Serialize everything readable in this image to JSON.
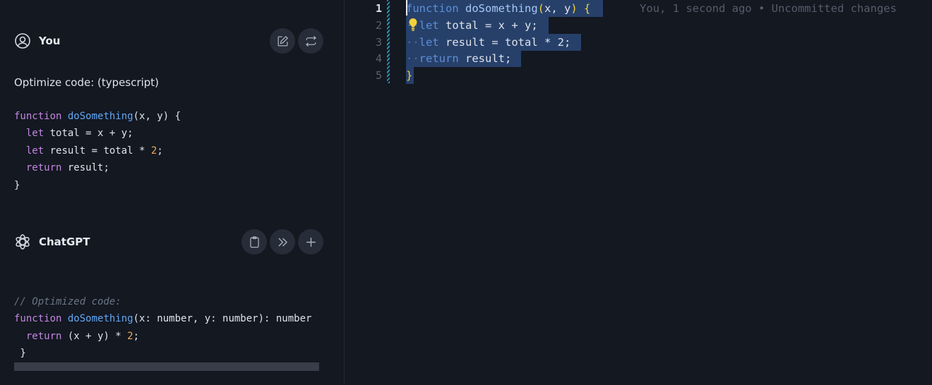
{
  "chat": {
    "user": {
      "author": "You",
      "prompt": "Optimize code:  (typescript)",
      "code_lines": [
        "function doSomething(x, y) {",
        "  let total = x + y;",
        "  let result = total * 2;",
        "  return result;",
        "}"
      ]
    },
    "assistant": {
      "author": "ChatGPT",
      "code_lines": [
        "// Optimized code:",
        "function doSomething(x: number, y: number): number",
        "  return (x + y) * 2;",
        " }"
      ]
    }
  },
  "editor": {
    "line_numbers": [
      "1",
      "2",
      "3",
      "4",
      "5"
    ],
    "active_line": "1",
    "blame": "You, 1 second ago • Uncommitted changes",
    "lines": [
      "function doSomething(x, y) {",
      "  let total = x + y;",
      "  let result = total * 2;",
      "  return result;",
      "}"
    ]
  },
  "icons": {
    "user_avatar": "user-circle-icon",
    "assistant_avatar": "openai-logo-icon",
    "edit": "pencil-square-icon",
    "regenerate": "repeat-arrows-icon",
    "copy": "clipboard-icon",
    "insert": "double-chevron-right-icon",
    "new": "plus-icon",
    "quick_fix": "lightbulb-icon"
  },
  "colors": {
    "background": "#131821",
    "selection": "#27406a",
    "keyword": "#c586e0",
    "function": "#61a8f4",
    "number": "#f0a85a",
    "bulb": "#f1d23c"
  }
}
